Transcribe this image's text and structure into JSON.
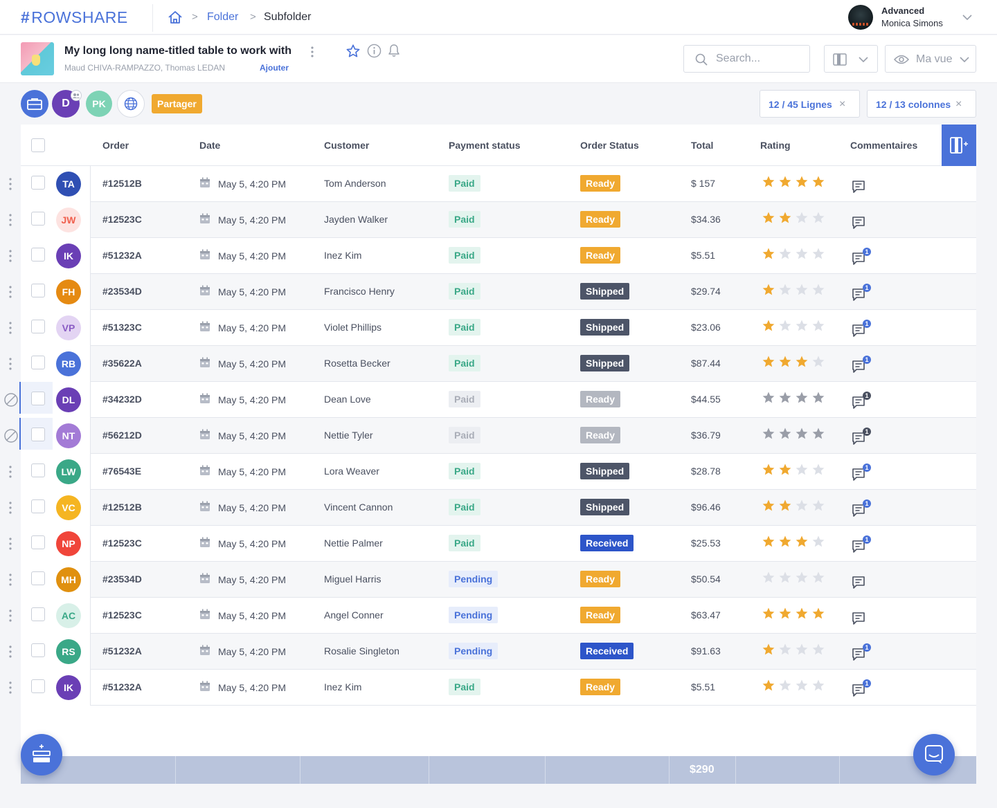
{
  "app": {
    "logo_hash": "#",
    "logo_text": "ROWSHARE"
  },
  "breadcrumb": {
    "separator": ">",
    "folder": "Folder",
    "subfolder": "Subfolder"
  },
  "user": {
    "plan": "Advanced",
    "name": "Monica Simons"
  },
  "document": {
    "title": "My long long name-titled table to work with",
    "authors": "Maud CHIVA-RAMPAZZO, Thomas LEDAN",
    "add_label": "Ajouter"
  },
  "search": {
    "placeholder": "Search..."
  },
  "view": {
    "label": "Ma vue"
  },
  "share": {
    "owner_initial": "D",
    "member_initials": "PK",
    "share_label": "Partager"
  },
  "filters": {
    "rows_label": "12 / 45 Lignes",
    "columns_label": "12 / 13 colonnes",
    "close": "×"
  },
  "table": {
    "columns": [
      "Order",
      "Date",
      "Customer",
      "Payment status",
      "Order Status",
      "Total",
      "Rating",
      "Commentaires"
    ],
    "rows": [
      {
        "initials": "TA",
        "avatar_bg": "#2f4fb3",
        "avatar_fg": "#ffffff",
        "order": "#12512B",
        "date": "May 5, 4:20 PM",
        "customer": "Tom Anderson",
        "payment": "Paid",
        "status": "Ready",
        "total": "$ 157",
        "rating": 4,
        "comments": 0,
        "disabled": false
      },
      {
        "initials": "JW",
        "avatar_bg": "#fde3e1",
        "avatar_fg": "#f0604e",
        "order": "#12523C",
        "date": "May 5, 4:20 PM",
        "customer": "Jayden Walker",
        "payment": "Paid",
        "status": "Ready",
        "total": "$34.36",
        "rating": 2,
        "comments": 0,
        "disabled": false
      },
      {
        "initials": "IK",
        "avatar_bg": "#6a3fb5",
        "avatar_fg": "#ffffff",
        "order": "#51232A",
        "date": "May 5, 4:20 PM",
        "customer": "Inez Kim",
        "payment": "Paid",
        "status": "Ready",
        "total": "$5.51",
        "rating": 1,
        "comments": 1,
        "disabled": false
      },
      {
        "initials": "FH",
        "avatar_bg": "#e58a12",
        "avatar_fg": "#ffffff",
        "order": "#23534D",
        "date": "May 5, 4:20 PM",
        "customer": "Francisco Henry",
        "payment": "Paid",
        "status": "Shipped",
        "total": "$29.74",
        "rating": 1,
        "comments": 1,
        "disabled": false
      },
      {
        "initials": "VP",
        "avatar_bg": "#e3d4f3",
        "avatar_fg": "#8a5cc4",
        "order": "#51323C",
        "date": "May 5, 4:20 PM",
        "customer": "Violet Phillips",
        "payment": "Paid",
        "status": "Shipped",
        "total": "$23.06",
        "rating": 1,
        "comments": 1,
        "disabled": false
      },
      {
        "initials": "RB",
        "avatar_bg": "#4a72d9",
        "avatar_fg": "#ffffff",
        "order": "#35622A",
        "date": "May 5, 4:20 PM",
        "customer": "Rosetta Becker",
        "payment": "Paid",
        "status": "Shipped",
        "total": "$87.44",
        "rating": 3,
        "comments": 1,
        "disabled": false
      },
      {
        "initials": "DL",
        "avatar_bg": "#6a3fb5",
        "avatar_fg": "#ffffff",
        "order": "#34232D",
        "date": "May 5, 4:20 PM",
        "customer": "Dean Love",
        "payment": "Paid",
        "status": "Ready",
        "total": "$44.55",
        "rating": 4,
        "comments": 1,
        "disabled": true
      },
      {
        "initials": "NT",
        "avatar_bg": "#a37bd6",
        "avatar_fg": "#ffffff",
        "order": "#56212D",
        "date": "May 5, 4:20 PM",
        "customer": "Nettie Tyler",
        "payment": "Paid",
        "status": "Ready",
        "total": "$36.79",
        "rating": 4,
        "comments": 1,
        "disabled": true
      },
      {
        "initials": "LW",
        "avatar_bg": "#3aa887",
        "avatar_fg": "#ffffff",
        "order": "#76543E",
        "date": "May 5, 4:20 PM",
        "customer": "Lora Weaver",
        "payment": "Paid",
        "status": "Shipped",
        "total": "$28.78",
        "rating": 2,
        "comments": 1,
        "disabled": false
      },
      {
        "initials": "VC",
        "avatar_bg": "#f5b522",
        "avatar_fg": "#ffffff",
        "order": "#12512B",
        "date": "May 5, 4:20 PM",
        "customer": "Vincent Cannon",
        "payment": "Paid",
        "status": "Shipped",
        "total": "$96.46",
        "rating": 2,
        "comments": 1,
        "disabled": false
      },
      {
        "initials": "NP",
        "avatar_bg": "#f0453a",
        "avatar_fg": "#ffffff",
        "order": "#12523C",
        "date": "May 5, 4:20 PM",
        "customer": "Nettie Palmer",
        "payment": "Paid",
        "status": "Received",
        "total": "$25.53",
        "rating": 3,
        "comments": 1,
        "disabled": false
      },
      {
        "initials": "MH",
        "avatar_bg": "#e0900f",
        "avatar_fg": "#ffffff",
        "order": "#23534D",
        "date": "May 5, 4:20 PM",
        "customer": "Miguel Harris",
        "payment": "Pending",
        "status": "Ready",
        "total": "$50.54",
        "rating": 0,
        "comments": 0,
        "disabled": false
      },
      {
        "initials": "AC",
        "avatar_bg": "#d8f0e8",
        "avatar_fg": "#3aa887",
        "order": "#12523C",
        "date": "May 5, 4:20 PM",
        "customer": "Angel Conner",
        "payment": "Pending",
        "status": "Ready",
        "total": "$63.47",
        "rating": 4,
        "comments": 0,
        "disabled": false
      },
      {
        "initials": "RS",
        "avatar_bg": "#3aa887",
        "avatar_fg": "#ffffff",
        "order": "#51232A",
        "date": "May 5, 4:20 PM",
        "customer": "Rosalie Singleton",
        "payment": "Pending",
        "status": "Received",
        "total": "$91.63",
        "rating": 1,
        "comments": 1,
        "disabled": false
      },
      {
        "initials": "IK",
        "avatar_bg": "#6a3fb5",
        "avatar_fg": "#ffffff",
        "order": "#51232A",
        "date": "May 5, 4:20 PM",
        "customer": "Inez Kim",
        "payment": "Paid",
        "status": "Ready",
        "total": "$5.51",
        "rating": 1,
        "comments": 1,
        "disabled": false
      }
    ]
  },
  "footer": {
    "total": "$290"
  },
  "colors": {
    "accent": "#4a72d9",
    "paid_bg": "#e3f4ee",
    "paid_fg": "#3aa887",
    "pending_bg": "#e7edfb",
    "pending_fg": "#4a72d9",
    "ready": "#f0a930",
    "shipped": "#4d5568",
    "received": "#2d55c9",
    "disabled_bg": "#b3b7c0",
    "disabled_soft_bg": "#eceef2",
    "disabled_soft_fg": "#a9adb7",
    "star_on": "#f0a930",
    "star_off": "#dcdfe6",
    "star_disabled": "#9a9ea8"
  }
}
